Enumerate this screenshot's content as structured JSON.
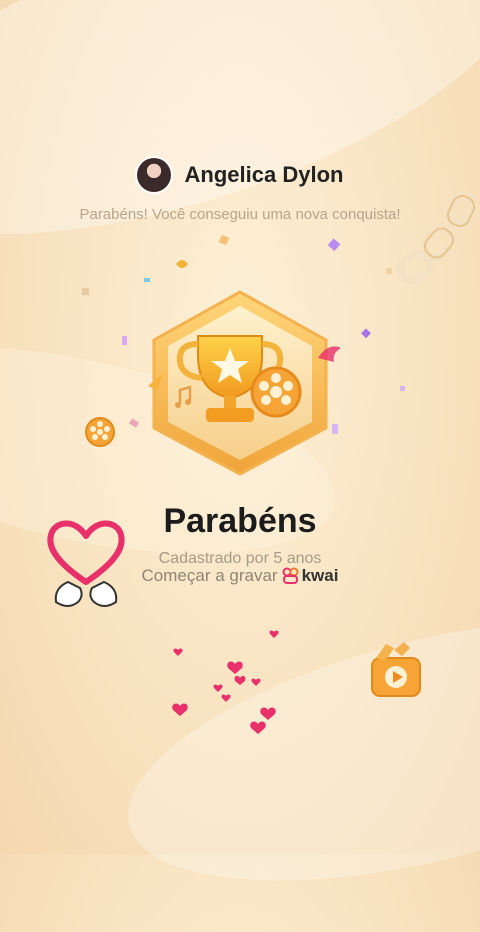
{
  "user": {
    "name": "Angelica Dylon"
  },
  "header": {
    "subtitle": "Parabéns! Você conseguiu uma nova conquista!"
  },
  "achievement": {
    "title": "Parabéns",
    "registered": "Cadastrado por 5 anos",
    "start_prompt": "Começar a gravar",
    "brand": "kwai"
  },
  "colors": {
    "accent": "#e8306a",
    "gold": "#f5b23c",
    "title": "#1c1c1c"
  },
  "icons": [
    "trophy-icon",
    "film-reel-icon",
    "camera-icon",
    "heart-hands-icon",
    "kwai-logo-icon"
  ]
}
